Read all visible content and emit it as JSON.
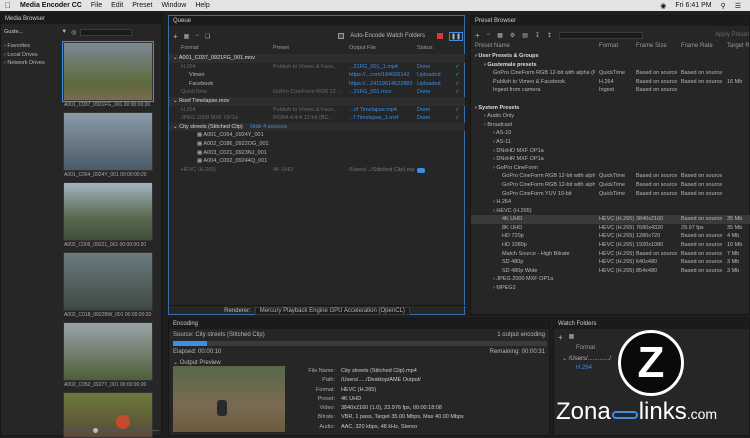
{
  "menubar": {
    "app": "Media Encoder CC",
    "items": [
      "File",
      "Edit",
      "Preset",
      "Window",
      "Help"
    ],
    "clock": "Fri 6:41 PM"
  },
  "media_browser": {
    "title": "Media Browser",
    "location": "Guste...",
    "tree": [
      "Favorites",
      "Local Drives",
      "Network Drives"
    ],
    "thumbs": [
      {
        "name": "A001_C037_0921FG_001",
        "dur": "00:00:00:20"
      },
      {
        "name": "A001_C064_0924Y_001",
        "dur": "00:00:00:20"
      },
      {
        "name": "A002_C009_09221_001",
        "dur": "00:00:00:20"
      },
      {
        "name": "A002_C018_0922BW_001",
        "dur": "00:00:00:20"
      },
      {
        "name": "A002_C052_0927T_001",
        "dur": "00:00:00:20"
      },
      {
        "name": "",
        "dur": ""
      }
    ]
  },
  "queue": {
    "title": "Queue",
    "auto_label": "Auto-Encode Watch Folders",
    "cols": [
      "Format",
      "Preset",
      "Output File",
      "Status"
    ],
    "items": [
      {
        "name": "A001_C037_0921FG_001.mov",
        "rows": [
          {
            "fmt": "H.264",
            "preset": "Publish to Vimeo & Face...",
            "out": "...21FG_001_1.mp4",
            "status": "Done"
          },
          {
            "fmt": "Vimeo",
            "preset": "",
            "out": "https://...com/184066142",
            "status": "Uploaded"
          },
          {
            "fmt": "Facebook",
            "preset": "",
            "out": "https://...24119614622883",
            "status": "Uploaded"
          },
          {
            "fmt": "QuickTime",
            "preset": "GoPro CineForm RGB 12 ...",
            "out": "...21FG_001.mov",
            "status": "Done"
          }
        ]
      },
      {
        "name": "Roof Timelapse.mov",
        "rows": [
          {
            "fmt": "H.264",
            "preset": "Publish to Vimeo & Face...",
            "out": "...of Timelapse.mp4",
            "status": "Done"
          },
          {
            "fmt": "JPEG 2000 MXF OP1a",
            "preset": "RGBA 4:4:4 12-bit (BC...",
            "out": "...f Timelapse_1.mxf",
            "status": "Done"
          }
        ]
      },
      {
        "name": "City streets (Stitched Clip)",
        "hide": "Hide 4 sources",
        "sources": [
          "A001_C064_0924Y_001",
          "A002_C086_0922OG_001",
          "A003_C021_0923NJ_001",
          "A004_C002_09244Q_001"
        ],
        "rows": [
          {
            "fmt": "HEVC (H.265)",
            "preset": "4K UHD",
            "out": "/Users/.../Stitched Clip).mp4",
            "status": ""
          }
        ]
      }
    ],
    "renderer_label": "Renderer:",
    "renderer": "Mercury Playback Engine GPU Acceleration (OpenCL)"
  },
  "encoding": {
    "title": "Encoding",
    "source": "Source: City streets (Stitched Clip)",
    "outputs": "1 output encoding",
    "elapsed": "Elapsed: 00:00:10",
    "remaining": "Remaining: 00:00:31",
    "preview": "Output Preview",
    "progress": 0.38,
    "info": [
      {
        "k": "File Name:",
        "v": "City streets (Stitched Clip).mp4"
      },
      {
        "k": "Path:",
        "v": "/Users/...../Desktop/AME Output/"
      },
      {
        "k": "Format:",
        "v": "HEVC (H.265)"
      },
      {
        "k": "Preset:",
        "v": "4K UHD"
      },
      {
        "k": "Video:",
        "v": "3840x2160 (1.0), 23.976 fps, 00:00:18:08"
      },
      {
        "k": "Bitrate:",
        "v": "VBR, 1 pass, Target 35.00 Mbps, Max 40.00 Mbps"
      },
      {
        "k": "Audio:",
        "v": "AAC, 320 kbps, 48 kHz, Stereo"
      }
    ]
  },
  "preset_browser": {
    "title": "Preset Browser",
    "apply": "Apply Preset",
    "cols": [
      "Preset Name",
      "Format",
      "Frame Size",
      "Frame Rate",
      "Target R"
    ],
    "rows": [
      {
        "n": "User Presets & Groups",
        "f": "",
        "s": "",
        "r": "",
        "t": "",
        "lvl": 0,
        "bold": true
      },
      {
        "n": "Gustemale presets",
        "f": "",
        "s": "",
        "r": "",
        "t": "",
        "lvl": 1,
        "bold": true
      },
      {
        "n": "GoPro CineForm RGB 12-bit with alpha (Ma...",
        "f": "QuickTime",
        "s": "Based on source",
        "r": "Based on source",
        "t": "",
        "lvl": 2
      },
      {
        "n": "Publish to Vimeo & Facebook",
        "f": "H.264",
        "s": "Based on source",
        "r": "Based on source",
        "t": "16 Mb",
        "lvl": 2
      },
      {
        "n": "Ingest from camera",
        "f": "Ingest",
        "s": "Based on source",
        "r": "",
        "t": "",
        "lvl": 2
      },
      {
        "n": "",
        "f": "",
        "s": "",
        "r": "",
        "t": "",
        "lvl": 0
      },
      {
        "n": "System Presets",
        "f": "",
        "s": "",
        "r": "",
        "t": "",
        "lvl": 0,
        "bold": true
      },
      {
        "n": "Audio Only",
        "f": "",
        "s": "",
        "r": "",
        "t": "",
        "lvl": 1
      },
      {
        "n": "Broadcast",
        "f": "",
        "s": "",
        "r": "",
        "t": "",
        "lvl": 1
      },
      {
        "n": "AS-10",
        "f": "",
        "s": "",
        "r": "",
        "t": "",
        "lvl": 2
      },
      {
        "n": "AS-11",
        "f": "",
        "s": "",
        "r": "",
        "t": "",
        "lvl": 2
      },
      {
        "n": "DNxHD MXF OP1a",
        "f": "",
        "s": "",
        "r": "",
        "t": "",
        "lvl": 2
      },
      {
        "n": "DNxHR MXF OP1a",
        "f": "",
        "s": "",
        "r": "",
        "t": "",
        "lvl": 2
      },
      {
        "n": "GoPro CineForm",
        "f": "",
        "s": "",
        "r": "",
        "t": "",
        "lvl": 2
      },
      {
        "n": "GoPro CineForm RGB 12-bit with alpha",
        "f": "QuickTime",
        "s": "Based on source",
        "r": "Based on source",
        "t": "",
        "lvl": 3
      },
      {
        "n": "GoPro CineForm RGB 12-bit with alpha",
        "f": "QuickTime",
        "s": "Based on source",
        "r": "Based on source",
        "t": "",
        "lvl": 3
      },
      {
        "n": "GoPro CineForm YUV 10-bit",
        "f": "QuickTime",
        "s": "Based on source",
        "r": "Based on source",
        "t": "",
        "lvl": 3
      },
      {
        "n": "H.264",
        "f": "",
        "s": "",
        "r": "",
        "t": "",
        "lvl": 2
      },
      {
        "n": "HEVC (H.265)",
        "f": "",
        "s": "",
        "r": "",
        "t": "",
        "lvl": 2
      },
      {
        "n": "4K UHD",
        "f": "HEVC (H.265)",
        "s": "3840x2160",
        "r": "Based on source",
        "t": "35 Mb",
        "lvl": 3,
        "sel": true
      },
      {
        "n": "8K UHD",
        "f": "HEVC (H.265)",
        "s": "7680x4320",
        "r": "29.97 fps",
        "t": "35 Mb",
        "lvl": 3
      },
      {
        "n": "HD 720p",
        "f": "HEVC (H.265)",
        "s": "1280x720",
        "r": "Based on source",
        "t": "4 Mb",
        "lvl": 3
      },
      {
        "n": "HD 1080p",
        "f": "HEVC (H.265)",
        "s": "1920x1080",
        "r": "Based on source",
        "t": "10 Mb",
        "lvl": 3
      },
      {
        "n": "Match Source - High Bitrate",
        "f": "HEVC (H.265)",
        "s": "Based on source",
        "r": "Based on source",
        "t": "7 Mb",
        "lvl": 3
      },
      {
        "n": "SD 480p",
        "f": "HEVC (H.265)",
        "s": "640x480",
        "r": "Based on source",
        "t": "3 Mb",
        "lvl": 3
      },
      {
        "n": "SD 480p Wide",
        "f": "HEVC (H.265)",
        "s": "854x480",
        "r": "Based on source",
        "t": "3 Mb",
        "lvl": 3
      },
      {
        "n": "JPEG 2000 MXF OP1a",
        "f": "",
        "s": "",
        "r": "",
        "t": "",
        "lvl": 2
      },
      {
        "n": "MPEG2",
        "f": "",
        "s": "",
        "r": "",
        "t": "",
        "lvl": 2
      }
    ]
  },
  "watch": {
    "title": "Watch Folders",
    "cols": [
      "Format"
    ],
    "folder": "/Users/............./",
    "fmt": "H.264"
  },
  "watermark": {
    "text_a": "Zona",
    "text_b": "links",
    "text_c": ".com"
  }
}
